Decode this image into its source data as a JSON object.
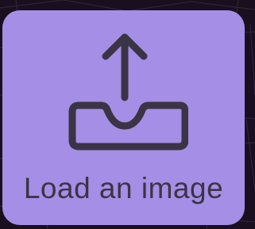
{
  "upload_card": {
    "label": "Load an image",
    "icon": "upload-tray-icon",
    "background_color": "#a58ee6",
    "icon_color": "#3a3445"
  },
  "page": {
    "background_color": "#1a0f1e"
  }
}
